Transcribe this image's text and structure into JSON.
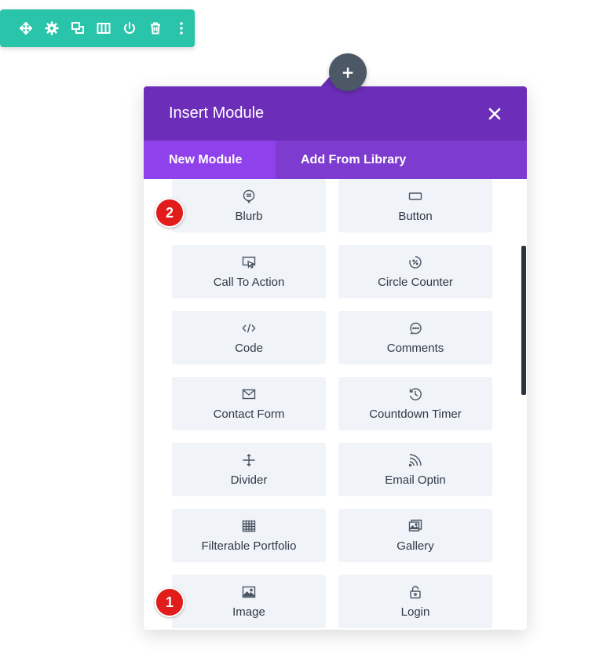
{
  "toolbar": {
    "color": "#29c4a9",
    "buttons": [
      "move-icon",
      "settings-icon",
      "duplicate-icon",
      "columns-icon",
      "save-icon",
      "delete-icon",
      "more-icon"
    ]
  },
  "add_button": {
    "glyph": "+"
  },
  "modal": {
    "title": "Insert Module",
    "close_glyph": "✕",
    "header_color": "#6c2eb9",
    "tabs": [
      {
        "label": "New Module",
        "active": true
      },
      {
        "label": "Add From Library",
        "active": false
      }
    ],
    "modules": [
      {
        "label": "Blurb",
        "icon": "blurb-icon"
      },
      {
        "label": "Button",
        "icon": "button-icon"
      },
      {
        "label": "Call To Action",
        "icon": "call-to-action-icon"
      },
      {
        "label": "Circle Counter",
        "icon": "circle-counter-icon"
      },
      {
        "label": "Code",
        "icon": "code-icon"
      },
      {
        "label": "Comments",
        "icon": "comments-icon"
      },
      {
        "label": "Contact Form",
        "icon": "contact-form-icon"
      },
      {
        "label": "Countdown Timer",
        "icon": "countdown-timer-icon"
      },
      {
        "label": "Divider",
        "icon": "divider-icon"
      },
      {
        "label": "Email Optin",
        "icon": "email-optin-icon"
      },
      {
        "label": "Filterable Portfolio",
        "icon": "filterable-portfolio-icon"
      },
      {
        "label": "Gallery",
        "icon": "gallery-icon"
      },
      {
        "label": "Image",
        "icon": "image-icon"
      },
      {
        "label": "Login",
        "icon": "login-icon"
      }
    ]
  },
  "annotations": [
    {
      "number": "1",
      "color": "#e21b1b"
    },
    {
      "number": "2",
      "color": "#e21b1b"
    }
  ]
}
